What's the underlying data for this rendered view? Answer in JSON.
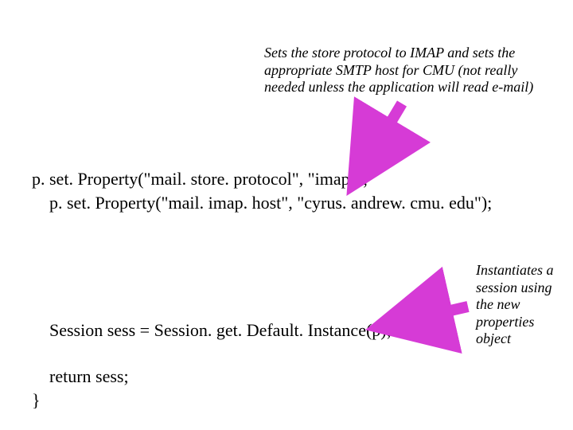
{
  "annotation_top": "Sets the store protocol to IMAP and sets the appropriate SMTP host for CMU (not really needed unless the application will read e-mail)",
  "annotation_right": "Instantiates a session using the new properties object",
  "code": {
    "line1": "p. set. Property(\"mail. store. protocol\", \"imap\");",
    "line2": "    p. set. Property(\"mail. imap. host\", \"cyrus. andrew. cmu. edu\");",
    "line3": "Session sess = Session. get. Default. Instance(p);",
    "line4": "return sess;",
    "line5": "}"
  },
  "arrow_color": "#d63bd6"
}
